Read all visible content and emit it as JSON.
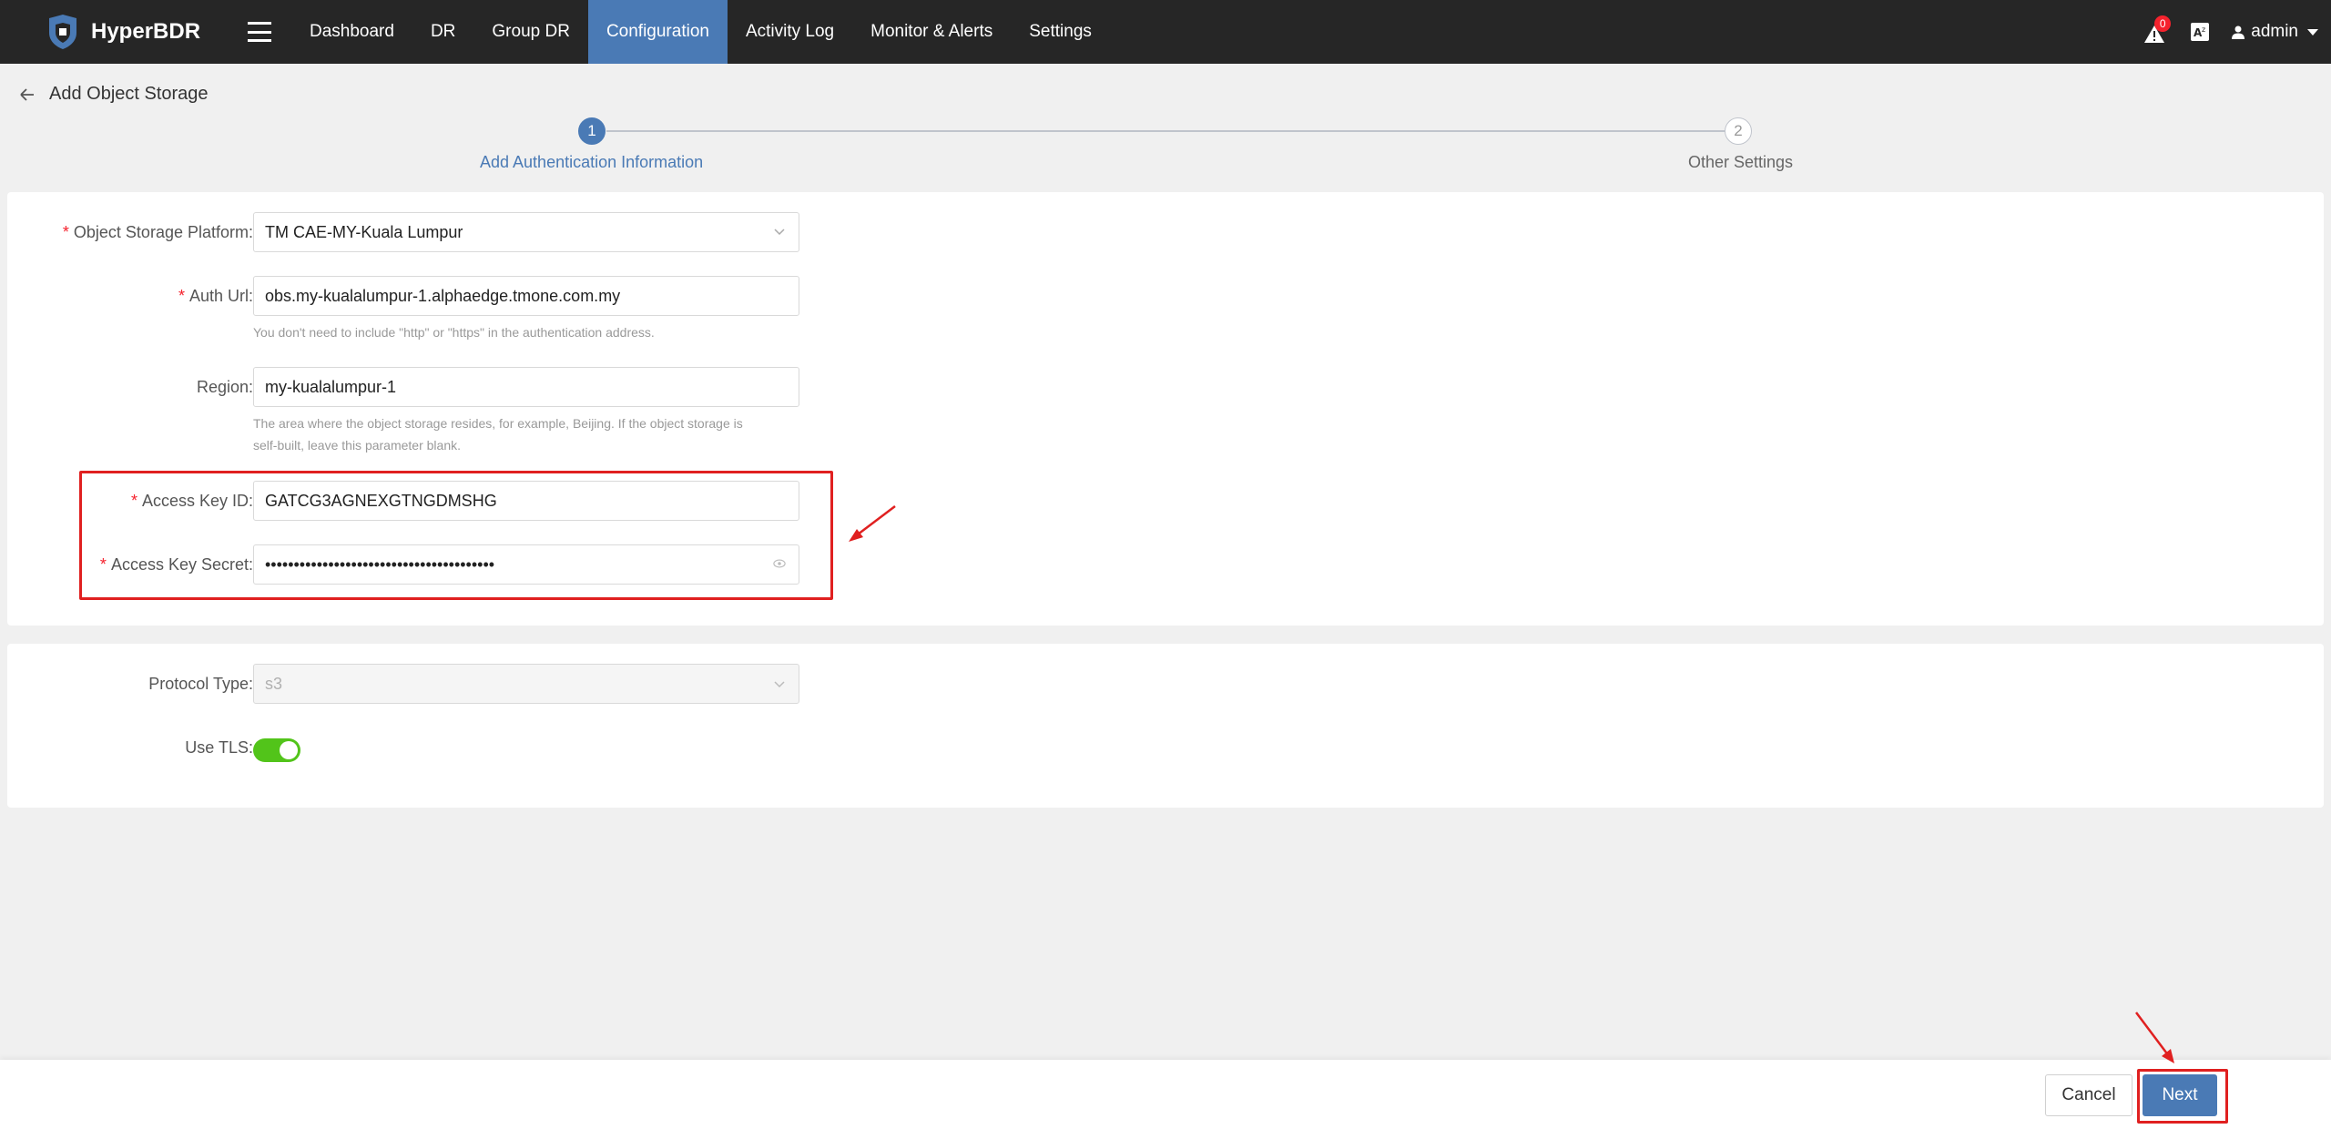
{
  "app": {
    "name": "HyperBDR"
  },
  "nav": {
    "items": [
      {
        "label": "Dashboard",
        "active": false
      },
      {
        "label": "DR",
        "active": false
      },
      {
        "label": "Group DR",
        "active": false
      },
      {
        "label": "Configuration",
        "active": true
      },
      {
        "label": "Activity Log",
        "active": false
      },
      {
        "label": "Monitor & Alerts",
        "active": false
      },
      {
        "label": "Settings",
        "active": false
      }
    ],
    "alert_count": "0",
    "user": "admin"
  },
  "page": {
    "title": "Add Object Storage"
  },
  "steps": [
    {
      "number": "1",
      "label": "Add Authentication Information",
      "active": true
    },
    {
      "number": "2",
      "label": "Other Settings",
      "active": false
    }
  ],
  "form": {
    "platform": {
      "label": "Object Storage Platform:",
      "value": "TM CAE-MY-Kuala Lumpur",
      "required": true
    },
    "auth_url": {
      "label": "Auth Url:",
      "value": "obs.my-kualalumpur-1.alphaedge.tmone.com.my",
      "required": true,
      "hint": "You don't need to include \"http\" or \"https\" in the authentication address."
    },
    "region": {
      "label": "Region:",
      "value": "my-kualalumpur-1",
      "required": false,
      "hint_line1": "The area where the object storage resides, for example, Beijing. If the object storage is",
      "hint_line2": "self-built, leave this parameter blank."
    },
    "access_key_id": {
      "label": "Access Key ID:",
      "value": "GATCG3AGNEXGTNGDMSHG",
      "required": true
    },
    "access_key_secret": {
      "label": "Access Key Secret:",
      "value": "••••••••••••••••••••••••••••••••••••••••",
      "required": true
    },
    "protocol_type": {
      "label": "Protocol Type:",
      "value": "s3",
      "disabled": true
    },
    "use_tls": {
      "label": "Use TLS:",
      "enabled": true
    }
  },
  "footer": {
    "cancel_label": "Cancel",
    "next_label": "Next"
  },
  "colors": {
    "accent": "#4a7ab5",
    "nav_bg": "#262626",
    "toggle_on": "#52c41a",
    "highlight": "#e02020",
    "required": "#f5222d"
  }
}
